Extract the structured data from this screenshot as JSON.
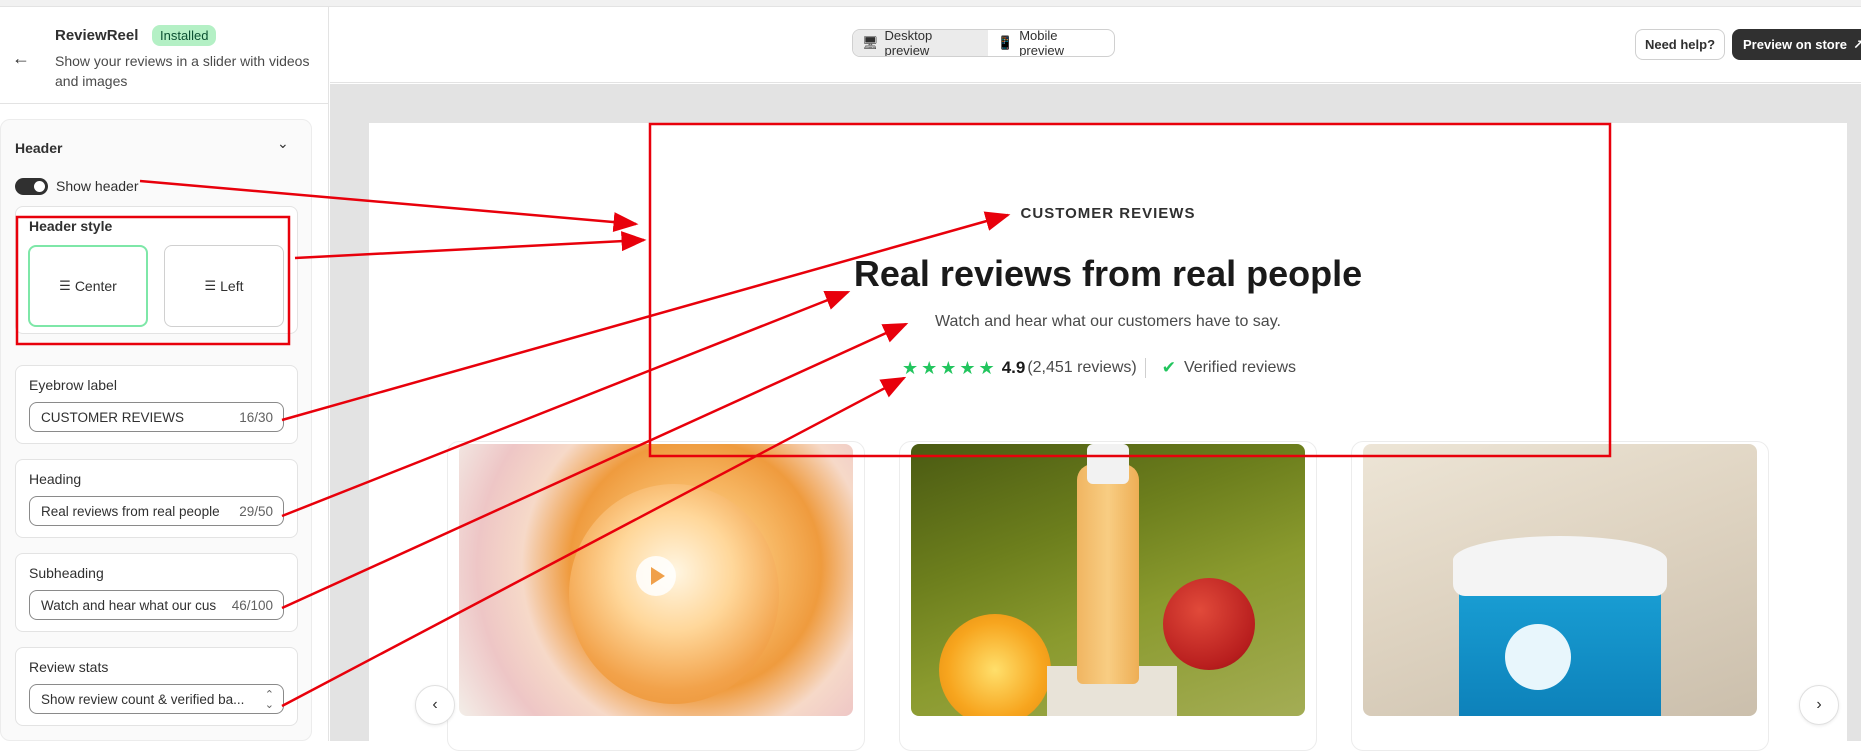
{
  "app": {
    "name": "ReviewReel",
    "badge": "Installed",
    "description": "Show your reviews in a slider with videos and images"
  },
  "sidebar": {
    "section_title": "Header",
    "show_header_label": "Show header",
    "show_header_on": true,
    "header_style": {
      "title": "Header style",
      "options": [
        "Center",
        "Left"
      ],
      "selected": "Center"
    },
    "eyebrow": {
      "label": "Eyebrow label",
      "value": "CUSTOMER REVIEWS",
      "count": "16/30"
    },
    "heading": {
      "label": "Heading",
      "value": "Real reviews from real people",
      "count": "29/50"
    },
    "subheading": {
      "label": "Subheading",
      "value": "Watch and hear what our cus",
      "count": "46/100"
    },
    "review_stats": {
      "label": "Review stats",
      "value": "Show review count & verified ba..."
    }
  },
  "topbar": {
    "desktop_preview": "Desktop preview",
    "mobile_preview": "Mobile preview",
    "active_preview": "Desktop preview",
    "need_help": "Need help?",
    "preview_on_store": "Preview on store"
  },
  "preview": {
    "eyebrow": "CUSTOMER REVIEWS",
    "heading": "Real reviews from real people",
    "subheading": "Watch and hear what our customers have to say.",
    "stars": "★★★★★",
    "rating": "4.9",
    "review_count": "(2,451 reviews)",
    "verified": "Verified reviews"
  },
  "colors": {
    "accent_green": "#22c55e",
    "annotation_red": "#e8000b",
    "selected_border": "#7ee7a8",
    "dark_button": "#303030"
  },
  "icons": {
    "back": "arrow-left-icon",
    "chevron": "chevron-down-icon",
    "desktop": "desktop-icon",
    "mobile": "mobile-icon",
    "external": "external-arrow-icon",
    "verified": "verified-user-icon",
    "play": "play-icon",
    "prev": "chevron-left-icon",
    "next": "chevron-right-icon"
  }
}
